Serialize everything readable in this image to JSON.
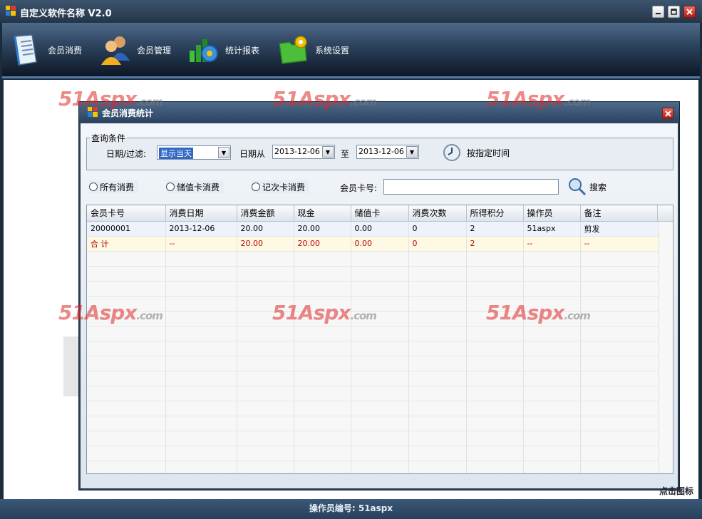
{
  "window": {
    "title": "自定义软件名称 V2.0"
  },
  "toolbar": {
    "items": [
      {
        "label": "会员消费",
        "icon": "document-icon"
      },
      {
        "label": "会员管理",
        "icon": "users-icon"
      },
      {
        "label": "统计报表",
        "icon": "report-icon"
      },
      {
        "label": "系统设置",
        "icon": "settings-folder-icon"
      }
    ]
  },
  "watermark": {
    "main": "51Aspx",
    "suffix": ".com"
  },
  "dialog": {
    "title": "会员消费统计",
    "query": {
      "legend": "查询条件",
      "filter_label": "日期/过滤:",
      "filter_value": "显示当天",
      "date_from_label": "日期从",
      "date_from": "2013-12-06",
      "to_label": "至",
      "date_to": "2013-12-06",
      "time_button": "按指定时间"
    },
    "radios": {
      "all": "所有消费",
      "stored": "储值卡消费",
      "times": "记次卡消费"
    },
    "card_label": "会员卡号:",
    "card_value": "",
    "search_button": "搜索",
    "table": {
      "headers": [
        "会员卡号",
        "消费日期",
        "消费金额",
        "现金",
        "储值卡",
        "消费次数",
        "所得积分",
        "操作员",
        "备注"
      ],
      "rows": [
        [
          "20000001",
          "2013-12-06",
          "20.00",
          "20.00",
          "0.00",
          "0",
          "2",
          "51aspx",
          "剪发"
        ]
      ],
      "total": [
        "合 计",
        "--",
        "20.00",
        "20.00",
        "0.00",
        "0",
        "2",
        "--",
        "--"
      ]
    }
  },
  "status": {
    "operator": "操作员编号: 51aspx",
    "corner": "点击图标"
  },
  "colors": {
    "accent": "#3168c6",
    "total_text": "#c00000",
    "title_bar": "#2b4260"
  }
}
